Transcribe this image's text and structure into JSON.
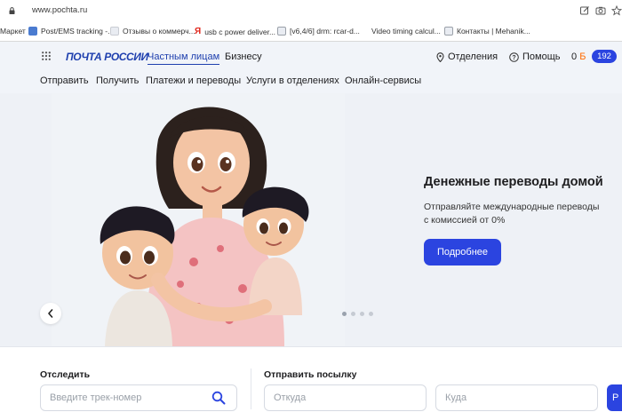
{
  "browser": {
    "url": "www.pochta.ru",
    "bookmarks": [
      {
        "label": "Маркет"
      },
      {
        "label": "Post/EMS tracking -..."
      },
      {
        "label": "Отзывы о коммерч..."
      },
      {
        "label": "usb c power deliver..."
      },
      {
        "label": "[v6,4/6] drm: rcar-d..."
      },
      {
        "label": "Video timing calcul..."
      },
      {
        "label": "Контакты | Mehanik..."
      }
    ]
  },
  "header": {
    "logo": "ПОЧТА РОССИИ",
    "nav": [
      "Частным лицам",
      "Бизнесу"
    ],
    "offices": "Отделения",
    "help": "Помощь",
    "points": "0",
    "points_unit": "Б",
    "badge": "192"
  },
  "subnav": [
    "Отправить",
    "Получить",
    "Платежи и переводы",
    "Услуги в отделениях",
    "Онлайн-сервисы"
  ],
  "hero": {
    "title": "Денежные переводы домой",
    "text": "Отправляйте международные переводы с комиссией от 0%",
    "button": "Подробнее",
    "slides_total": 4,
    "slide_active": 1
  },
  "track": {
    "label": "Отследить",
    "placeholder": "Введите трек-номер"
  },
  "send": {
    "label": "Отправить посылку",
    "from_placeholder": "Откуда",
    "to_placeholder": "Куда",
    "button_partial": "Р"
  }
}
